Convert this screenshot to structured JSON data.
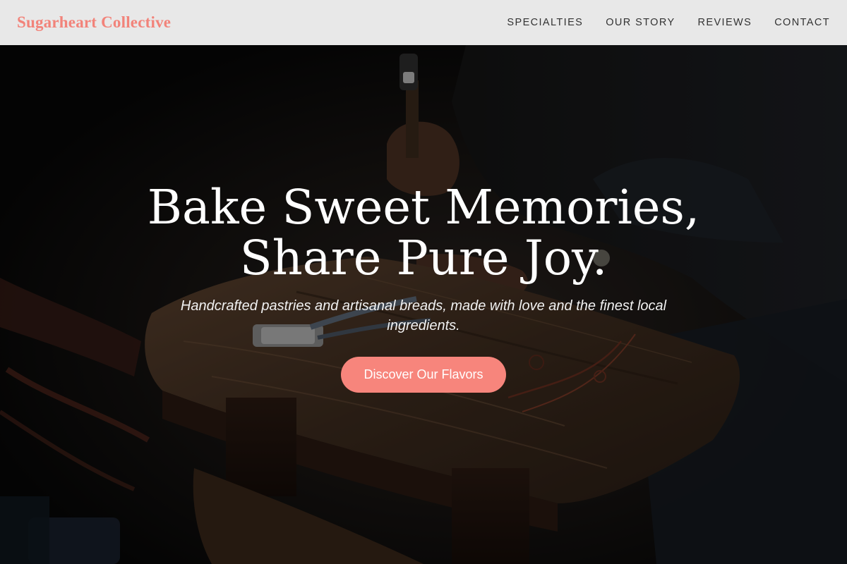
{
  "header": {
    "brand": "Sugarheart Collective",
    "nav": [
      {
        "label": "SPECIALTIES"
      },
      {
        "label": "OUR STORY"
      },
      {
        "label": "REVIEWS"
      },
      {
        "label": "CONTACT"
      }
    ]
  },
  "hero": {
    "title_line1": "Bake Sweet Memories,",
    "title_line2": "Share Pure Joy.",
    "subtitle": "Handcrafted pastries and artisanal breads, made with love and the finest local ingredients.",
    "cta_label": "Discover Our Flavors",
    "background_image_alt": "Gingerbread love"
  },
  "colors": {
    "brand": "#f2837a",
    "cta": "#f7857c",
    "navbar_bg": "#e8e8e8",
    "hero_text": "#ffffff"
  }
}
